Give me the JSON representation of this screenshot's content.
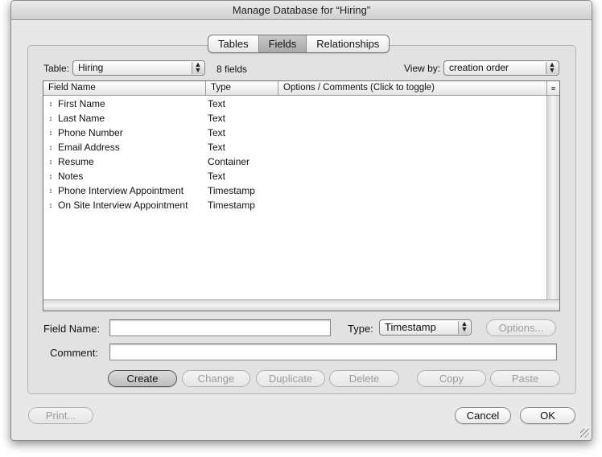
{
  "window": {
    "title": "Manage Database for “Hiring”"
  },
  "tabs": [
    {
      "label": "Tables",
      "selected": false
    },
    {
      "label": "Fields",
      "selected": true
    },
    {
      "label": "Relationships",
      "selected": false
    }
  ],
  "table_select": {
    "label": "Table:",
    "value": "Hiring",
    "count": "8 fields"
  },
  "view_by": {
    "label": "View by:",
    "value": "creation order"
  },
  "columns": [
    "Field Name",
    "Type",
    "Options / Comments   (Click to toggle)"
  ],
  "fields": [
    {
      "name": "First Name",
      "type": "Text"
    },
    {
      "name": "Last Name",
      "type": "Text"
    },
    {
      "name": "Phone Number",
      "type": "Text"
    },
    {
      "name": "Email Address",
      "type": "Text"
    },
    {
      "name": "Resume",
      "type": "Container"
    },
    {
      "name": "Notes",
      "type": "Text"
    },
    {
      "name": "Phone Interview Appointment",
      "type": "Timestamp"
    },
    {
      "name": "On Site Interview Appointment",
      "type": "Timestamp"
    }
  ],
  "form": {
    "field_name_label": "Field Name:",
    "field_name_value": "",
    "type_label": "Type:",
    "type_value": "Timestamp",
    "options_button": "Options...",
    "comment_label": "Comment:",
    "comment_value": ""
  },
  "actions": {
    "create": "Create",
    "change": "Change",
    "duplicate": "Duplicate",
    "delete": "Delete",
    "copy": "Copy",
    "paste": "Paste"
  },
  "footer": {
    "print": "Print...",
    "cancel": "Cancel",
    "ok": "OK"
  },
  "icons": {
    "row_handle": "↕",
    "popup_arrows": "▲▼",
    "sort_indicator": "≡"
  }
}
